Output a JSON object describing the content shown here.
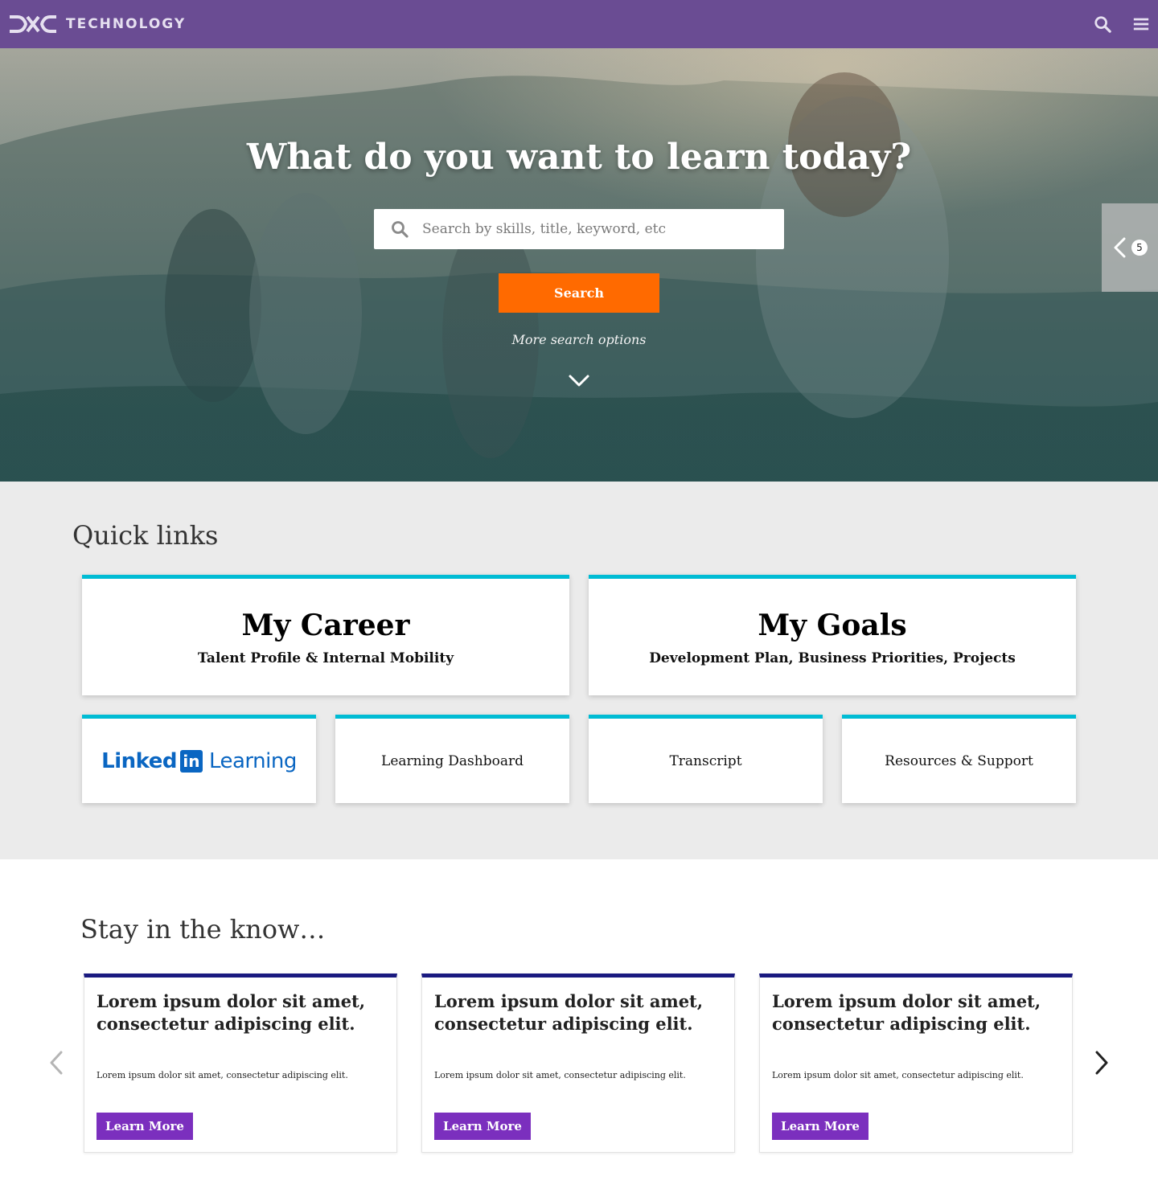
{
  "header": {
    "brand_text": "TECHNOLOGY",
    "brand_mark": "DXC",
    "icons": [
      "search-icon",
      "hamburger-menu-icon"
    ]
  },
  "hero": {
    "title": "What do you want to learn today?",
    "search": {
      "placeholder": "Search by skills, title, keyword, etc",
      "value": ""
    },
    "search_button": "Search",
    "more_options": "More search options",
    "side_tab_count": "5"
  },
  "quick_links": {
    "title": "Quick links",
    "primary": [
      {
        "title": "My Career",
        "subtitle": "Talent Profile & Internal Mobility"
      },
      {
        "title": "My Goals",
        "subtitle": "Development Plan, Business Priorities, Projects"
      }
    ],
    "secondary": [
      {
        "logo_linked": "Linked",
        "logo_in": "in",
        "logo_learning": "Learning"
      },
      {
        "label": "Learning Dashboard"
      },
      {
        "label": "Transcript"
      },
      {
        "label": "Resources & Support"
      }
    ]
  },
  "stay_in_the_know": {
    "title": "Stay in the know…",
    "cards": [
      {
        "title": "Lorem ipsum dolor sit amet, consectetur adipiscing elit.",
        "body": "Lorem ipsum dolor sit amet, consectetur adipiscing elit.",
        "button": "Learn More"
      },
      {
        "title": "Lorem ipsum dolor sit amet, consectetur adipiscing elit.",
        "body": "Lorem ipsum dolor sit amet, consectetur adipiscing elit.",
        "button": "Learn More"
      },
      {
        "title": "Lorem ipsum dolor sit amet, consectetur adipiscing elit.",
        "body": "Lorem ipsum dolor sit amet, consectetur adipiscing elit.",
        "button": "Learn More"
      }
    ]
  },
  "colors": {
    "nav_bg": "#6a4c93",
    "accent_orange": "#ff6a00",
    "card_top_border": "#00bcd4",
    "news_top_border": "#1a1a80",
    "button_purple": "#7b2fbe",
    "linkedin_blue": "#0a66c2"
  }
}
